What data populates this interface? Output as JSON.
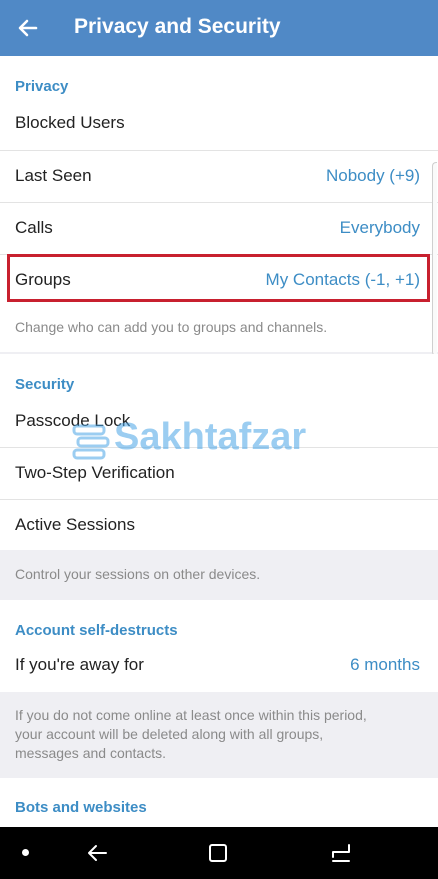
{
  "header": {
    "title": "Privacy and Security"
  },
  "privacy": {
    "header": "Privacy",
    "blocked_users": "Blocked Users",
    "last_seen": {
      "label": "Last Seen",
      "value": "Nobody (+9)"
    },
    "calls": {
      "label": "Calls",
      "value": "Everybody"
    },
    "groups": {
      "label": "Groups",
      "value": "My Contacts (-1, +1)"
    },
    "groups_info": "Change who can add you to groups and channels."
  },
  "security": {
    "header": "Security",
    "passcode_lock": "Passcode Lock",
    "two_step": "Two-Step Verification",
    "active_sessions": "Active Sessions",
    "sessions_info": "Control your sessions on other devices."
  },
  "self_destruct": {
    "header": "Account self-destructs",
    "away_for": {
      "label": "If you're away for",
      "value": "6 months"
    },
    "info_line1": "If you do not come online at least once within this period,",
    "info_line2": "your account will be deleted along with all groups,",
    "info_line3": "messages and contacts."
  },
  "bots": {
    "header": "Bots and websites"
  },
  "watermark": {
    "text": "Sakhtafzar"
  },
  "colors": {
    "appbar": "#5089c6",
    "accent": "#3d8dc5",
    "highlight": "#c8202f"
  },
  "icons": {
    "back": "arrow-left-icon",
    "nav_back": "nav-back-icon",
    "nav_home": "nav-home-icon",
    "nav_recent": "nav-recent-icon"
  }
}
